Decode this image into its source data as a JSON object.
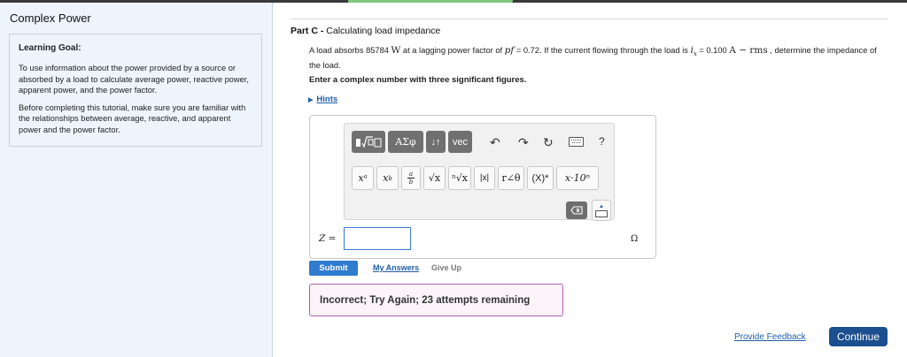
{
  "left": {
    "title": "Complex Power",
    "goal_heading": "Learning Goal:",
    "goal_p1": "To use information about the power provided by a source or absorbed by a load to calculate average power, reactive power, apparent power, and the power factor.",
    "goal_p2": "Before completing this tutorial, make sure you are familiar with the relationships between average, reactive, and apparent power and the power factor."
  },
  "part": {
    "label": "Part C -",
    "title": "Calculating load impedance"
  },
  "problem": {
    "t1": "A load absorbs 85784",
    "unit_w": "W",
    "t2": " at a lagging power factor of ",
    "pf_sym": "pf",
    "t3": " = 0.72. If the current flowing through the load is ",
    "i_sym": "i",
    "i_sub": "x",
    "t4": " = 0.100 ",
    "unit_a": "A − rms",
    "t5": " , determine the impedance of the load."
  },
  "instruction": "Enter a complex number with three significant figures.",
  "hints_label": "Hints",
  "toolbar": {
    "greek": "ΑΣφ",
    "sort": "↓↑",
    "vec": "vec",
    "undo": "↶",
    "redo": "↷",
    "reset": "↻",
    "help": "?",
    "x_power": "xᵃ",
    "x_sub": "x",
    "x_sub_b": "b",
    "frac_a": "a",
    "frac_b": "b",
    "sqrt": "√x",
    "nroot": "ⁿ√x",
    "abs": "|x|",
    "polar": "r∠θ",
    "conj": "(X)*",
    "sci": "x·10ⁿ"
  },
  "answer": {
    "label": "Z =",
    "value": "",
    "unit": "Ω"
  },
  "actions": {
    "submit": "Submit",
    "my_answers": "My Answers",
    "give_up": "Give Up"
  },
  "feedback": "Incorrect; Try Again; 23 attempts remaining",
  "footer": {
    "provide_feedback": "Provide Feedback",
    "continue": "Continue"
  }
}
